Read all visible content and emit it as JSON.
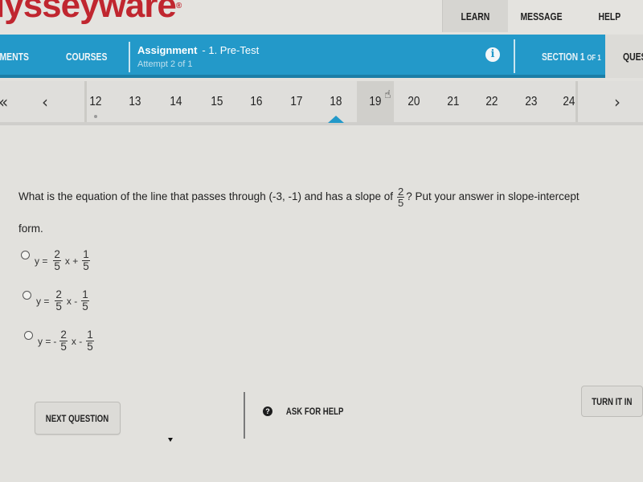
{
  "header": {
    "logo_text": "lysseyware",
    "logo_mark": "®",
    "nav": [
      {
        "label": "LEARN"
      },
      {
        "label": "MESSAGE"
      },
      {
        "label": "HELP"
      }
    ]
  },
  "assignment_bar": {
    "links": [
      {
        "label": "NMENTS"
      },
      {
        "label": "COURSES"
      }
    ],
    "title": "Assignment",
    "subtitle": "- 1. Pre-Test",
    "attempt": "Attempt 2 of 1",
    "info_icon": "info-icon",
    "section_prefix": "SECTION 1",
    "section_suffix": "OF 1",
    "right_tab": "QUEST"
  },
  "question_nav": {
    "first": "«",
    "prev": "‹",
    "next": "›",
    "numbers": [
      "12",
      "13",
      "14",
      "15",
      "16",
      "17",
      "18",
      "19",
      "20",
      "21",
      "22",
      "23",
      "24"
    ],
    "current": "18",
    "hovered": "19",
    "answered_marker": "12"
  },
  "question": {
    "text_before": "What is the equation of the line that passes through (-3, -1) and has a slope of",
    "slope_num": "2",
    "slope_den": "5",
    "text_after": "? Put your answer in slope-intercept",
    "text_line2": "form.",
    "choices": [
      {
        "prefix": "y =",
        "sign1": "",
        "n1": "2",
        "d1": "5",
        "mid": "x +",
        "n2": "1",
        "d2": "5"
      },
      {
        "prefix": "y =",
        "sign1": "",
        "n1": "2",
        "d1": "5",
        "mid": "x -",
        "n2": "1",
        "d2": "5"
      },
      {
        "prefix": "y =",
        "sign1": "-",
        "n1": "2",
        "d1": "5",
        "mid": "x -",
        "n2": "1",
        "d2": "5"
      }
    ]
  },
  "footer": {
    "next_question": "NEXT QUESTION",
    "ask_for_help": "ASK FOR HELP",
    "help_icon_glyph": "?",
    "turn_it_in": "TURN IT IN"
  },
  "colors": {
    "brand_red": "#c0262f",
    "accent_blue": "#2399c9",
    "background": "#e2e1dd"
  }
}
